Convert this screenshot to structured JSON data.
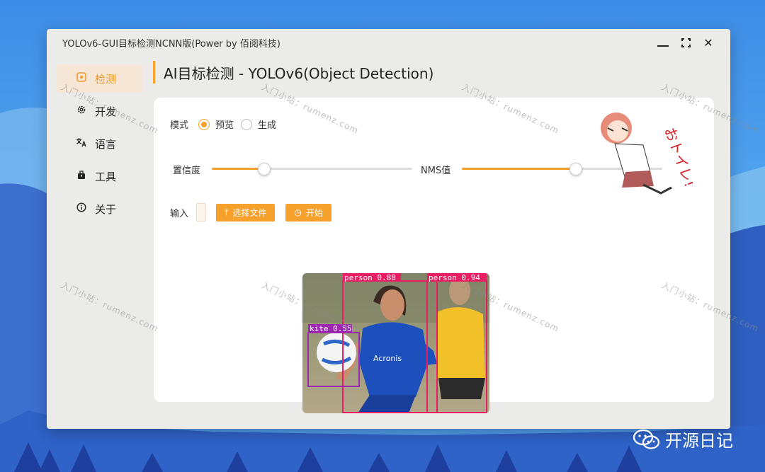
{
  "window": {
    "title": "YOLOv6-GUI目标检测NCNN版(Power by 佰阅科技)"
  },
  "sidebar": {
    "items": [
      {
        "label": "检测",
        "icon": "detect-icon",
        "active": true
      },
      {
        "label": "开发",
        "icon": "gear-icon",
        "active": false
      },
      {
        "label": "语言",
        "icon": "translate-icon",
        "active": false
      },
      {
        "label": "工具",
        "icon": "toolbox-icon",
        "active": false
      },
      {
        "label": "关于",
        "icon": "info-icon",
        "active": false
      }
    ]
  },
  "header": {
    "title": "AI目标检测 - YOLOv6(Object Detection)"
  },
  "controls": {
    "mode_label": "模式",
    "mode_options": [
      {
        "label": "预览",
        "checked": true
      },
      {
        "label": "生成",
        "checked": false
      }
    ],
    "confidence_label": "置信度",
    "confidence_value": 0.26,
    "nms_label": "NMS值",
    "nms_value": 0.57,
    "input_label": "输入",
    "choose_file_label": "选择文件",
    "start_label": "开始"
  },
  "detections": [
    {
      "label": "person 0.88",
      "color": "#e91e63"
    },
    {
      "label": "person 0.94",
      "color": "#e91e63"
    },
    {
      "label": "kite 0.55",
      "color": "#9c27b0"
    }
  ],
  "image_text": {
    "jersey": "Acronis"
  },
  "watermark": "入门小站：rumenz.com",
  "mascot_text": "おトイレ!",
  "brand": "开源日记",
  "colors": {
    "accent": "#f7a12d",
    "window_bg": "#ebebea",
    "panel_bg": "#ffffff"
  }
}
